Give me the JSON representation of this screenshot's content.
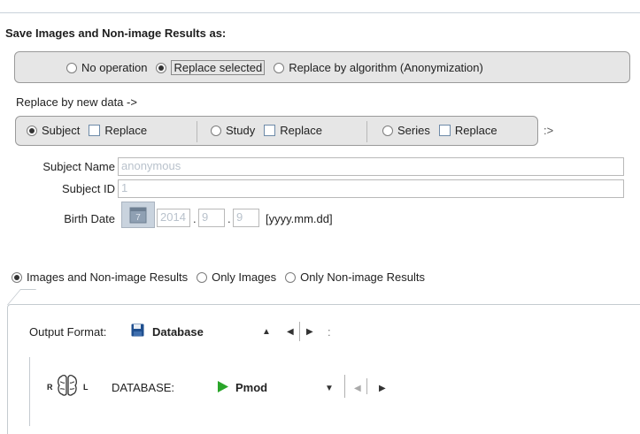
{
  "save_section": {
    "title": "Save Images and Non-image Results  as:",
    "mode_options": [
      {
        "label": "No operation",
        "checked": false
      },
      {
        "label": "Replace selected",
        "checked": true
      },
      {
        "label": "Replace by algorithm (Anonymization)",
        "checked": false
      }
    ]
  },
  "replace_section": {
    "label": "Replace by new data ->",
    "levels": [
      {
        "label": "Subject",
        "checked": true,
        "replace_label": "Replace",
        "replace_checked": false
      },
      {
        "label": "Study",
        "checked": false,
        "replace_label": "Replace",
        "replace_checked": false
      },
      {
        "label": "Series",
        "checked": false,
        "replace_label": "Replace",
        "replace_checked": false
      }
    ],
    "trailing": ":>"
  },
  "subject_fields": {
    "name_label": "Subject Name",
    "name_value": "anonymous",
    "id_label": "Subject ID",
    "id_value": "1",
    "birth_label": "Birth Date",
    "birth_year": "2014",
    "birth_month": "9",
    "birth_day": "9",
    "birth_dot": ".",
    "birth_format": "[yyyy.mm.dd]"
  },
  "scope_options": [
    {
      "label": "Images and Non-image Results",
      "checked": true
    },
    {
      "label": "Only Images",
      "checked": false
    },
    {
      "label": "Only Non-image Results",
      "checked": false
    }
  ],
  "output": {
    "label": "Output Format:",
    "value": "Database",
    "icon": "floppy-disk-icon",
    "nav_up": "▲",
    "nav_left": "◀",
    "nav_right": "▶",
    "nav_more": ":"
  },
  "database": {
    "label": "DATABASE:",
    "value": "Pmod",
    "icon": "brain-rl-icon",
    "r_letter": "R",
    "l_letter": "L",
    "nav_down": "▼",
    "nav_left": "◀",
    "nav_right": "▶"
  },
  "colors": {
    "panel": "#e6e6e6",
    "placeholder_text": "#b9c2cc",
    "floppy_blue": "#1f4f8f",
    "play_green": "#2aa52a"
  }
}
